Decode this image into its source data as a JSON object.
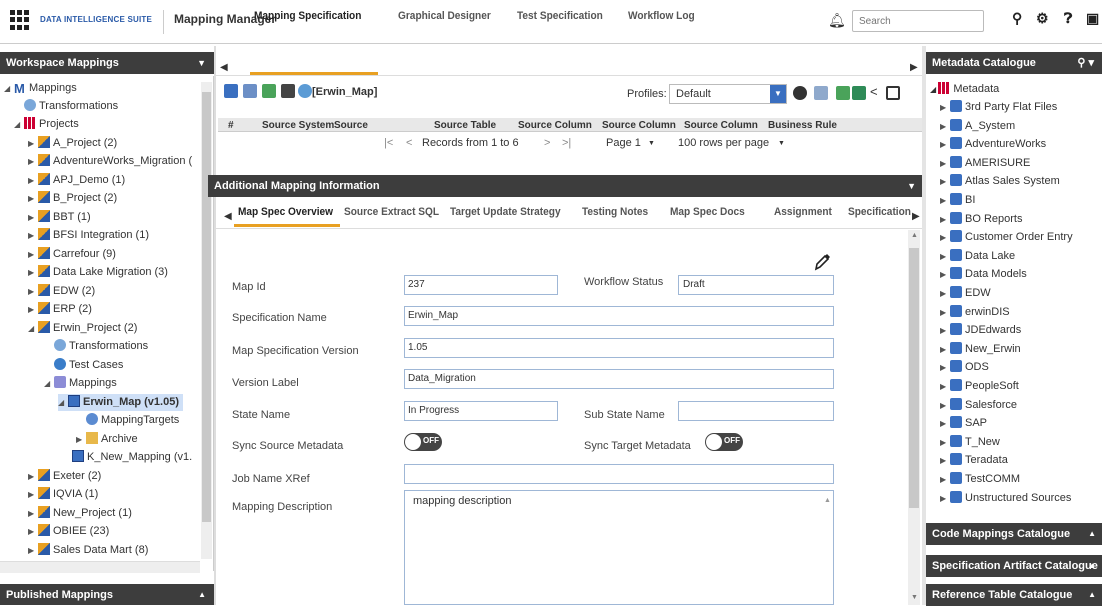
{
  "top": {
    "brand": "DATA INTELLIGENCE SUITE",
    "app_name": "Mapping Manager",
    "search_placeholder": "Search"
  },
  "left": {
    "header": "Workspace Mappings",
    "tree": [
      {
        "label": "Mappings",
        "icon": "mapping-root-icon"
      },
      {
        "label": "Transformations",
        "icon": "transformation-icon"
      },
      {
        "label": "Projects",
        "icon": "projects-grid-icon"
      },
      {
        "label": "A_Project (2)",
        "icon": "project-icon"
      },
      {
        "label": "AdventureWorks_Migration (",
        "icon": "project-icon"
      },
      {
        "label": "APJ_Demo (1)",
        "icon": "project-icon"
      },
      {
        "label": "B_Project (2)",
        "icon": "project-icon"
      },
      {
        "label": "BBT (1)",
        "icon": "project-icon"
      },
      {
        "label": "BFSI Integration (1)",
        "icon": "project-icon"
      },
      {
        "label": "Carrefour (9)",
        "icon": "project-icon"
      },
      {
        "label": "Data Lake Migration (3)",
        "icon": "project-icon"
      },
      {
        "label": "EDW (2)",
        "icon": "project-icon"
      },
      {
        "label": "ERP (2)",
        "icon": "project-icon"
      },
      {
        "label": "Erwin_Project (2)",
        "icon": "project-icon"
      },
      {
        "label": "Transformations",
        "icon": "transformation-icon"
      },
      {
        "label": "Test Cases",
        "icon": "test-cases-icon"
      },
      {
        "label": "Mappings",
        "icon": "mappings-folder-icon"
      },
      {
        "label": "Erwin_Map (v1.05)",
        "icon": "mapping-table-icon"
      },
      {
        "label": "MappingTargets",
        "icon": "mapping-targets-icon"
      },
      {
        "label": "Archive",
        "icon": "archive-folder-icon"
      },
      {
        "label": "K_New_Mapping (v1.",
        "icon": "mapping-table-icon"
      },
      {
        "label": "Exeter (2)",
        "icon": "project-icon"
      },
      {
        "label": "IQVIA (1)",
        "icon": "project-icon"
      },
      {
        "label": "New_Project (1)",
        "icon": "project-icon"
      },
      {
        "label": "OBIEE (23)",
        "icon": "project-icon"
      },
      {
        "label": "Sales Data Mart (8)",
        "icon": "project-icon"
      }
    ],
    "published_header": "Published Mappings"
  },
  "tabs": [
    "Mapping Specification",
    "Graphical Designer",
    "Test Specification",
    "Workflow Log"
  ],
  "toolbar": {
    "map_label": "[Erwin_Map]",
    "profiles_label": "Profiles:",
    "profiles_value": "Default"
  },
  "grid": {
    "columns": [
      "#",
      "Source System",
      "Source",
      "Source Table",
      "Source Column",
      "Source Column",
      "Source Column",
      "Business Rule"
    ],
    "records": "Records from 1 to 6",
    "page": "Page 1",
    "rows_per_page": "100 rows per page"
  },
  "additional": {
    "header": "Additional Mapping Information",
    "subtabs": [
      "Map Spec Overview",
      "Source Extract SQL",
      "Target Update Strategy",
      "Testing Notes",
      "Map Spec Docs",
      "Assignment",
      "Specification"
    ]
  },
  "form": {
    "map_id_label": "Map Id",
    "map_id": "237",
    "workflow_status_label": "Workflow Status",
    "workflow_status": "Draft",
    "spec_name_label": "Specification Name",
    "spec_name": "Erwin_Map",
    "spec_version_label": "Map Specification Version",
    "spec_version": "1.05",
    "version_label_label": "Version Label",
    "version_label": "Data_Migration",
    "state_name_label": "State Name",
    "state_name": "In Progress",
    "sub_state_label": "Sub State Name",
    "sub_state": "",
    "sync_source_label": "Sync Source Metadata",
    "sync_source": "OFF",
    "sync_target_label": "Sync Target Metadata",
    "sync_target": "OFF",
    "job_name_label": "Job Name XRef",
    "job_name": "",
    "desc_label": "Mapping Description",
    "desc": "mapping description"
  },
  "right": {
    "header": "Metadata Catalogue",
    "root": "Metadata",
    "items": [
      "3rd Party Flat Files",
      "A_System",
      "AdventureWorks",
      "AMERISURE",
      "Atlas Sales System",
      "BI",
      "BO Reports",
      "Customer Order Entry",
      "Data Lake",
      "Data Models",
      "EDW",
      "erwinDIS",
      "JDEdwards",
      "New_Erwin",
      "ODS",
      "PeopleSoft",
      "Salesforce",
      "SAP",
      "T_New",
      "Teradata",
      "TestCOMM",
      "Unstructured Sources"
    ],
    "code_header": "Code Mappings Catalogue",
    "spec_header": "Specification Artifact Catalogue",
    "ref_header": "Reference Table Catalogue"
  },
  "colors": {
    "accent": "#e8a022",
    "header_bg": "#3d3d3d",
    "brand_blue": "#2a5aa8"
  }
}
